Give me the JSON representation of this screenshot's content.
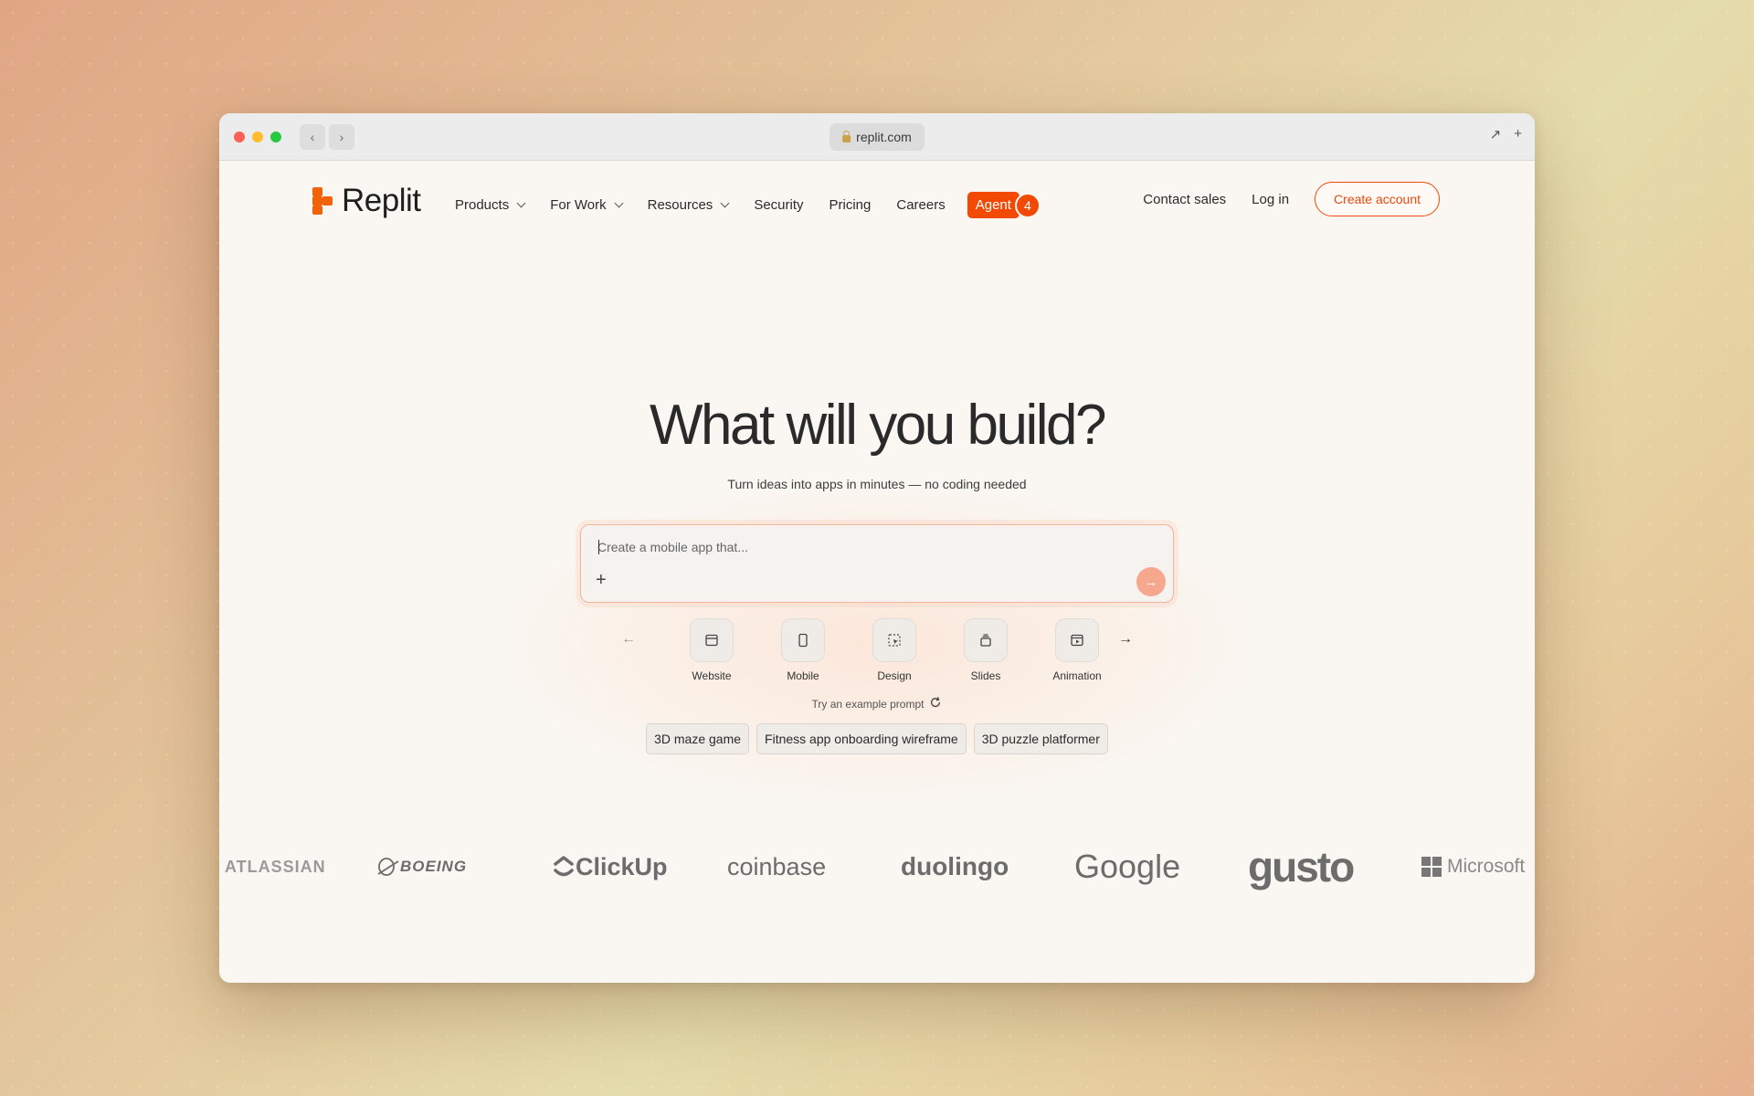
{
  "browser": {
    "url": "replit.com",
    "back_icon": "chevron-left-icon",
    "forward_icon": "chevron-right-icon"
  },
  "nav": {
    "brand": "Replit",
    "items": [
      {
        "label": "Products",
        "has_dropdown": true
      },
      {
        "label": "For Work",
        "has_dropdown": true
      },
      {
        "label": "Resources",
        "has_dropdown": true
      },
      {
        "label": "Security",
        "has_dropdown": false
      },
      {
        "label": "Pricing",
        "has_dropdown": false
      },
      {
        "label": "Careers",
        "has_dropdown": false
      }
    ],
    "agent_label": "Agent",
    "agent_count": "4",
    "contact_sales": "Contact sales",
    "login": "Log in",
    "create_account": "Create account"
  },
  "hero": {
    "title": "What will you build?",
    "subtitle": "Turn ideas into apps in minutes — no coding needed",
    "prompt_placeholder": "Create a mobile app that...",
    "app_types": [
      {
        "label": "Website",
        "icon": "browser-window-icon"
      },
      {
        "label": "Mobile",
        "icon": "phone-icon"
      },
      {
        "label": "Design",
        "icon": "design-cursor-icon"
      },
      {
        "label": "Slides",
        "icon": "slides-stack-icon"
      },
      {
        "label": "Animation",
        "icon": "animation-play-icon"
      }
    ],
    "example_label": "Try an example prompt",
    "examples": [
      "3D maze game",
      "Fitness app onboarding wireframe",
      "3D puzzle platformer"
    ]
  },
  "logos": [
    "ATLASSIAN",
    "BOEING",
    "ClickUp",
    "coinbase",
    "duolingo",
    "Google",
    "gusto",
    "Microsoft"
  ],
  "colors": {
    "accent": "#f24a04",
    "send_button": "#f5a88e",
    "prompt_border": "#f2b49b"
  }
}
